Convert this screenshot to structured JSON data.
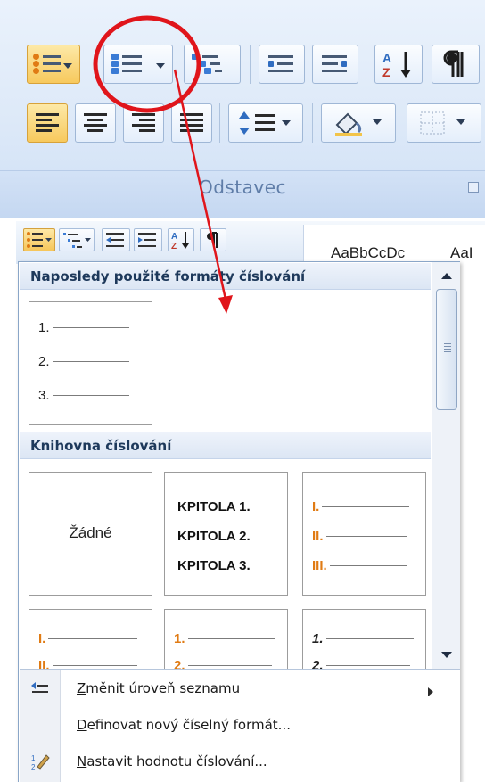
{
  "ribbon": {
    "group_label": "Odstavec",
    "styles_preview": [
      "AaBbCcDc",
      "AaI"
    ]
  },
  "dropdown": {
    "recent_header": "Naposledy použité formáty číslování",
    "recent_tile": [
      "1.",
      "2.",
      "3."
    ],
    "library_header": "Knihovna číslování",
    "library": {
      "none_label": "Žádné",
      "chapter": [
        "KPITOLA 1.",
        "KPITOLA 2.",
        "KPITOLA 3."
      ],
      "roman_orange": [
        "I.",
        "II.",
        "III."
      ],
      "row2_roman": [
        "I.",
        "II."
      ],
      "row2_orange_numbers": [
        "1.",
        "2."
      ],
      "row2_italic_numbers": [
        "1.",
        "2."
      ]
    },
    "menu": {
      "change_level_u": "Z",
      "change_level_rest": "měnit úroveň seznamu",
      "define_u": "D",
      "define_rest": "efinovat nový číselný formát...",
      "set_value_u": "N",
      "set_value_rest": "astavit hodnotu číslování..."
    }
  },
  "colors": {
    "accent_orange": "#e07b14",
    "annotation_red": "#e0151b",
    "header_blue": "#1e395b"
  },
  "icons": [
    "bullets-icon",
    "numbering-icon",
    "multilevel-list-icon",
    "decrease-indent-icon",
    "increase-indent-icon",
    "sort-icon",
    "pilcrow-icon",
    "align-left-icon",
    "align-center-icon",
    "align-right-icon",
    "justify-icon",
    "line-spacing-icon",
    "shading-icon",
    "borders-icon",
    "change-list-level-icon",
    "set-numbering-value-icon"
  ]
}
